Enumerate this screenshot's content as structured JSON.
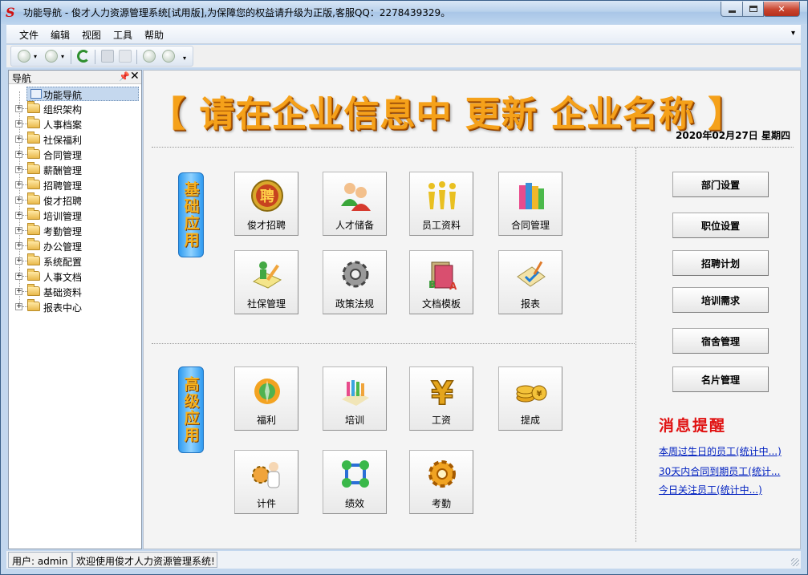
{
  "window": {
    "title": "功能导航 - 俊才人力资源管理系统[试用版],为保障您的权益请升级为正版,客服QQ：2278439329。",
    "app_icon_glyph": "S"
  },
  "menu": [
    "文件",
    "编辑",
    "视图",
    "工具",
    "帮助"
  ],
  "sidebar": {
    "title": "导航",
    "root": "功能导航",
    "items": [
      "组织架构",
      "人事档案",
      "社保福利",
      "合同管理",
      "薪酬管理",
      "招聘管理",
      "俊才招聘",
      "培训管理",
      "考勤管理",
      "办公管理",
      "系统配置",
      "人事文档",
      "基础资料",
      "报表中心"
    ]
  },
  "main": {
    "banner": "【 请在企业信息中 更新 企业名称 】",
    "date": "2020年02月27日 星期四",
    "basic_label": "基础应用",
    "advanced_label": "高级应用",
    "basic_tiles": [
      "俊才招聘",
      "人才储备",
      "员工资料",
      "合同管理",
      "社保管理",
      "政策法规",
      "文档模板",
      "报表"
    ],
    "advanced_tiles": [
      "福利",
      "培训",
      "工资",
      "提成",
      "计件",
      "绩效",
      "考勤"
    ],
    "side_buttons": [
      "部门设置",
      "职位设置",
      "招聘计划",
      "培训需求",
      "宿舍管理",
      "名片管理"
    ],
    "messages_title": "消息提醒",
    "messages": [
      "本周过生日的员工(统计中...)",
      "30天内合同到期员工(统计...",
      "今日关注员工(统计中...)"
    ]
  },
  "status": {
    "user": "用户: admin",
    "welcome": "欢迎使用俊才人力资源管理系统!"
  },
  "colors": {
    "accent_orange": "#f5a11a",
    "badge_blue": "#2f9bf0",
    "message_red": "#e01010",
    "link_blue": "#0020c0",
    "close_red": "#c9452f"
  }
}
